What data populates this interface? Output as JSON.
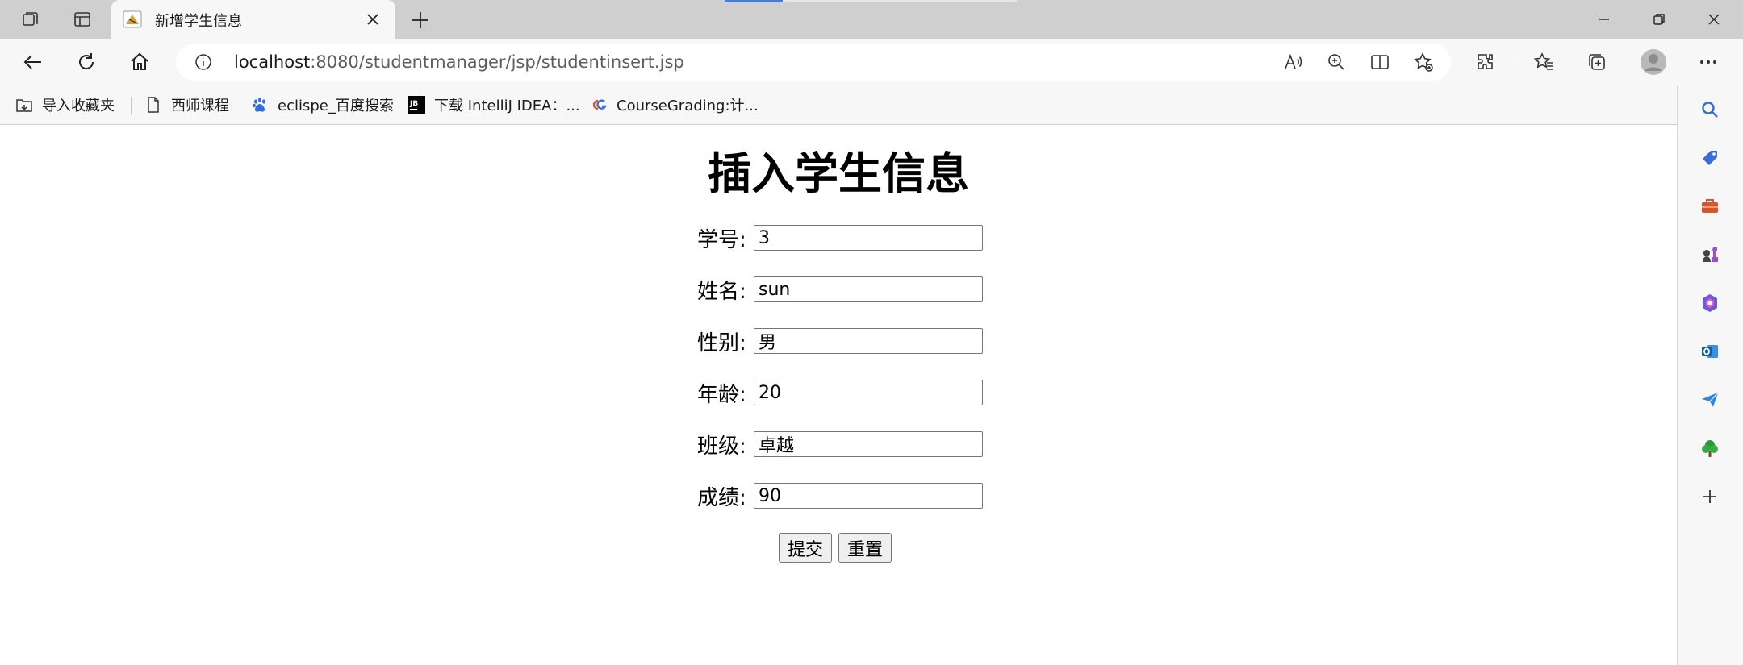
{
  "browser": {
    "tab": {
      "title": "新增学生信息"
    },
    "address": {
      "host": "localhost",
      "path": ":8080/studentmanager/jsp/studentinsert.jsp"
    },
    "bookmarks": [
      {
        "label": "导入收藏夹",
        "icon": "import-folder-icon"
      },
      {
        "label": "西师课程",
        "icon": "document-icon"
      },
      {
        "label": "eclispe_百度搜索",
        "icon": "baidu-paw-icon"
      },
      {
        "label": "下载 IntelliJ IDEA：...",
        "icon": "jetbrains-icon"
      },
      {
        "label": "CourseGrading:计...",
        "icon": "coursegrading-icon"
      }
    ]
  },
  "page": {
    "title": "插入学生信息",
    "fields": [
      {
        "label": "学号:",
        "value": "3"
      },
      {
        "label": "姓名:",
        "value": "sun"
      },
      {
        "label": "性别:",
        "value": "男"
      },
      {
        "label": "年龄:",
        "value": "20"
      },
      {
        "label": "班级:",
        "value": "卓越"
      },
      {
        "label": "成绩:",
        "value": "90"
      }
    ],
    "submit_label": "提交",
    "reset_label": "重置"
  }
}
